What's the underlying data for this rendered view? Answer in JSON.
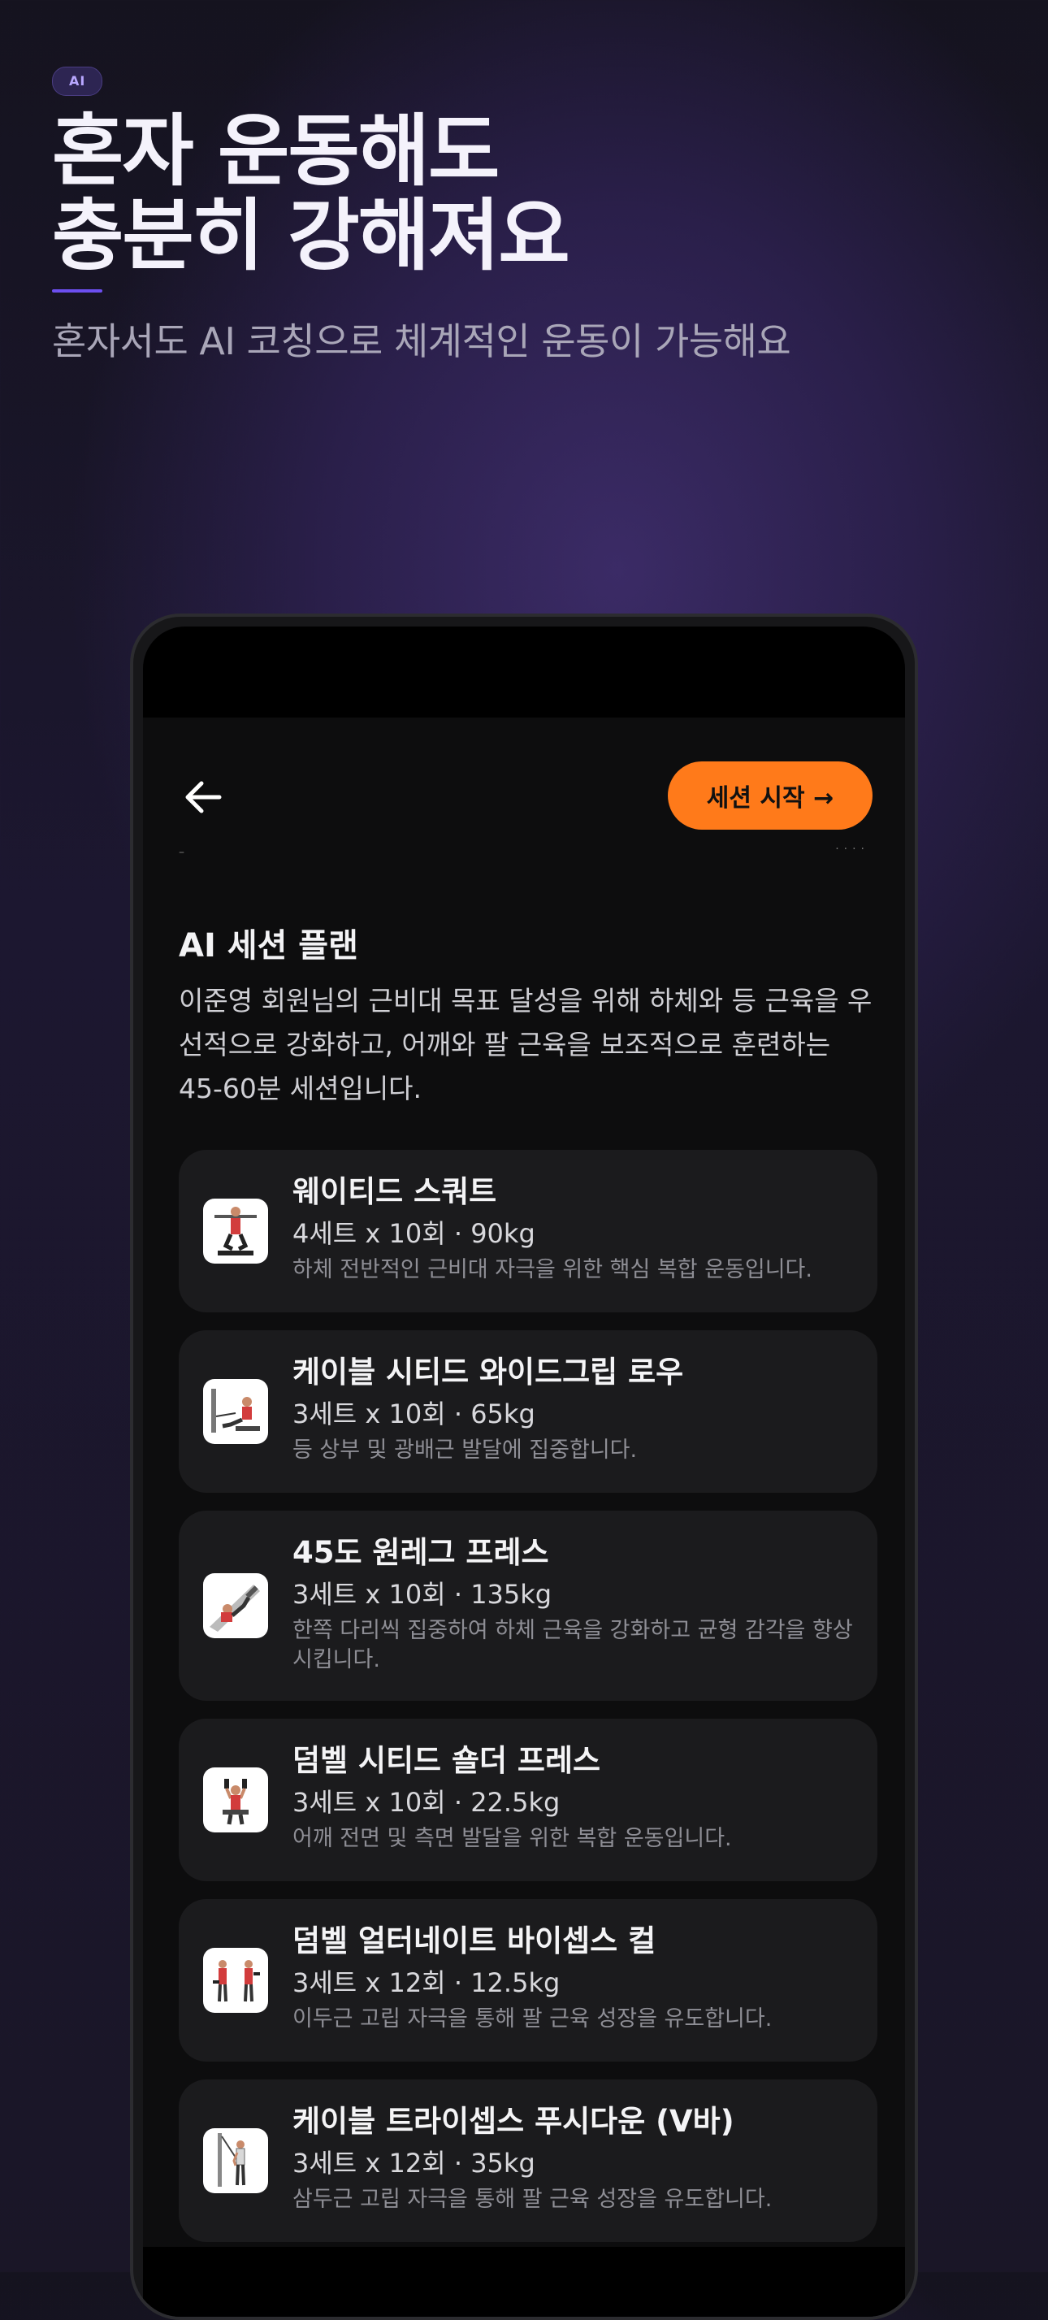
{
  "hero": {
    "badge": "AI",
    "title_line1": "혼자 운동해도",
    "title_line2": "충분히 강해져요",
    "subtitle": "혼자서도 AI 코칭으로 체계적인 운동이 가능해요"
  },
  "header": {
    "start_button": "세션 시작 →"
  },
  "plan": {
    "title": "AI 세션 플랜",
    "description": "이준영 회원님의 근비대 목표 달성을 위해 하체와 등 근육을 우선적으로 강화하고, 어깨와 팔 근육을 보조적으로 훈련하는 45-60분 세션입니다."
  },
  "exercises": [
    {
      "name": "웨이티드 스쿼트",
      "sets": "4세트 x 10회 · 90kg",
      "desc": "하체 전반적인 근비대 자극을 위한 핵심 복합 운동입니다.",
      "thumb_icon": "squat-illustration-icon"
    },
    {
      "name": "케이블 시티드 와이드그립 로우",
      "sets": "3세트 x 10회 · 65kg",
      "desc": "등 상부 및 광배근 발달에 집중합니다.",
      "thumb_icon": "cable-row-illustration-icon"
    },
    {
      "name": "45도 원레그 프레스",
      "sets": "3세트 x 10회 · 135kg",
      "desc": "한쪽 다리씩 집중하여 하체 근육을 강화하고 균형 감각을 향상시킵니다.",
      "thumb_icon": "leg-press-illustration-icon"
    },
    {
      "name": "덤벨 시티드 숄더 프레스",
      "sets": "3세트 x 10회 · 22.5kg",
      "desc": "어깨 전면 및 측면 발달을 위한 복합 운동입니다.",
      "thumb_icon": "shoulder-press-illustration-icon"
    },
    {
      "name": "덤벨 얼터네이트 바이셉스 컬",
      "sets": "3세트 x 12회 · 12.5kg",
      "desc": "이두근 고립 자극을 통해 팔 근육 성장을 유도합니다.",
      "thumb_icon": "biceps-curl-illustration-icon"
    },
    {
      "name": "케이블 트라이셉스 푸시다운 (V바)",
      "sets": "3세트 x 12회 · 35kg",
      "desc": "삼두근 고립 자극을 통해 팔 근육 성장을 유도합니다.",
      "thumb_icon": "triceps-pushdown-illustration-icon"
    }
  ],
  "colors": {
    "accent_orange": "#ff7a1a",
    "badge_purple": "#6c4ff0",
    "card_bg": "#1b1b1d",
    "screen_bg": "#0d0d0e"
  }
}
